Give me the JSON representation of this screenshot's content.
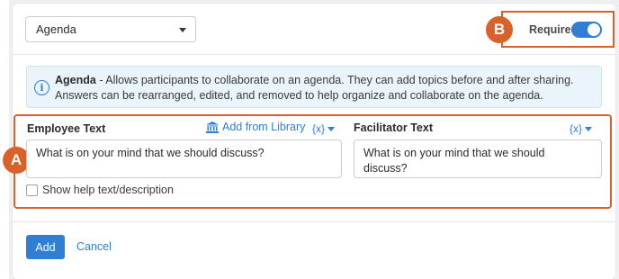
{
  "dropdown": {
    "selected": "Agenda"
  },
  "required": {
    "label": "Required",
    "on": true
  },
  "badges": {
    "a": "A",
    "b": "B"
  },
  "info": {
    "title": "Agenda",
    "description": " - Allows participants to collaborate on an agenda. They can add topics before and after sharing. Answers can be rearranged, edited, and removed to help organize and collaborate on the agenda."
  },
  "employee": {
    "label": "Employee Text",
    "add_from_library": "Add from Library",
    "var_label": "{x}",
    "value": "What is on your mind that we should discuss?"
  },
  "facilitator": {
    "label": "Facilitator Text",
    "var_label": "{x}",
    "value": "What is on your mind that we should discuss?"
  },
  "help_text": {
    "label": "Show help text/description",
    "checked": false
  },
  "actions": {
    "add": "Add",
    "cancel": "Cancel"
  },
  "colors": {
    "accent": "#2f7fd4",
    "callout": "#d9622b",
    "info_bg": "#eaf4fb"
  }
}
